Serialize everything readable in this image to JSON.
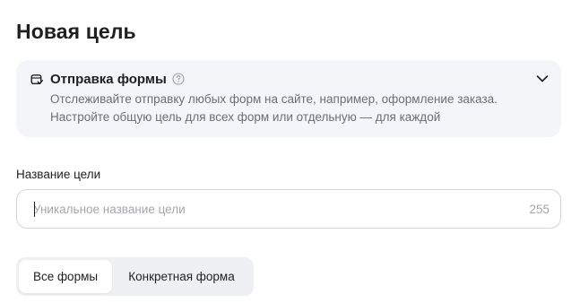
{
  "page": {
    "title": "Новая цель"
  },
  "goal_type": {
    "icon": "form-submit-icon",
    "title": "Отправка формы",
    "help_icon": "question-circle-icon",
    "expand_icon": "chevron-down-icon",
    "description_line1": "Отслеживайте отправку любых форм на сайте, например, оформление заказа.",
    "description_line2": "Настройте общую цель для всех форм или отдельную — для каждой"
  },
  "goal_name": {
    "label": "Название цели",
    "placeholder": "Уникальное название цели",
    "value": "",
    "char_limit": "255"
  },
  "form_scope": {
    "options": [
      {
        "label": "Все формы",
        "selected": true
      },
      {
        "label": "Конкретная форма",
        "selected": false
      }
    ]
  },
  "colors": {
    "card_background": "#f4f5f9",
    "muted_text": "#6b6e76",
    "placeholder_text": "#a3a6ad",
    "border": "#d3d5db"
  }
}
